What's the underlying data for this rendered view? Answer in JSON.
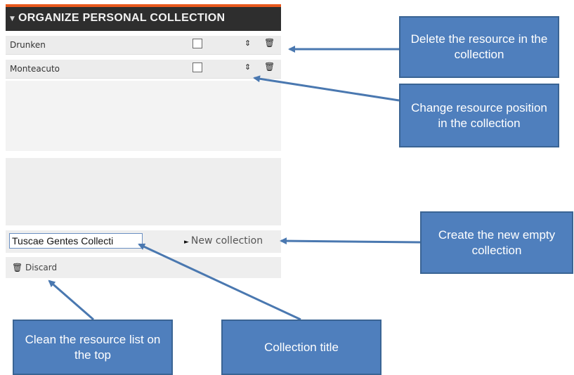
{
  "panel": {
    "title": "ORGANIZE PERSONAL COLLECTION",
    "toggle_glyph": "▼",
    "items": [
      {
        "name": "Drunken",
        "checked": false
      },
      {
        "name": "Monteacuto",
        "checked": false
      }
    ],
    "sort_glyph": "⇕",
    "trash_glyph": "🗑",
    "collection_title_value": "Tuscae Gentes Collecti",
    "new_collection_label": "New collection",
    "new_collection_arrow": "►",
    "discard_label": "Discard"
  },
  "callouts": {
    "delete": "Delete the resource in the collection",
    "position": "Change resource position in the collection",
    "create": "Create the new empty collection",
    "clean": "Clean the resource list on the top",
    "title": "Collection title"
  },
  "colors": {
    "header_bg": "#2e2e2e",
    "header_accent": "#e8591e",
    "callout_bg": "#4f7fbd",
    "arrow": "#4a78b0"
  }
}
